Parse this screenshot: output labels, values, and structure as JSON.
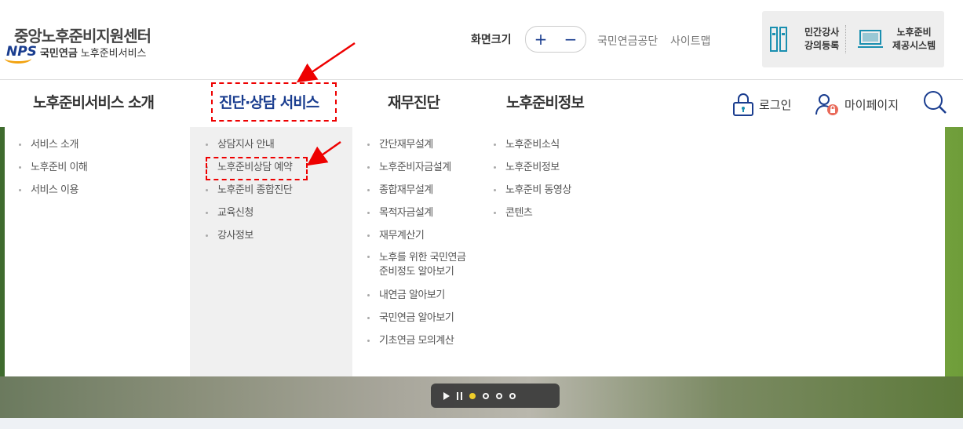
{
  "header": {
    "site_title": "중앙노후준비지원센터",
    "nps_logo": "NPS",
    "org_name": "국민연금",
    "service_name": "노후준비서비스",
    "zoom_label": "화면크기",
    "zoom_in": "+",
    "zoom_out": "−",
    "link_nps": "국민연금공단",
    "link_sitemap": "사이트맵",
    "ext_lecture_line1": "민간강사",
    "ext_lecture_line2": "강의등록",
    "ext_system_line1": "노후준비",
    "ext_system_line2": "제공시스템"
  },
  "nav": {
    "items": [
      "노후준비서비스 소개",
      "진단·상담 서비스",
      "재무진단",
      "노후준비정보"
    ],
    "active_index": 1,
    "login": "로그인",
    "mypage": "마이페이지"
  },
  "mega_menu": {
    "col1": [
      "서비스 소개",
      "노후준비 이해",
      "서비스 이용"
    ],
    "col2": [
      "상담지사 안내",
      "노후준비상담 예약",
      "노후준비 종합진단",
      "교육신청",
      "강사정보"
    ],
    "col3": [
      "간단재무설계",
      "노후준비자금설계",
      "종합재무설계",
      "목적자금설계",
      "재무계산기",
      "노후를 위한 국민연금",
      "준비정도 알아보기",
      "내연금 알아보기",
      "국민연금 알아보기",
      "기초연금 모의계산"
    ],
    "col4": [
      "노후준비소식",
      "노후준비정보",
      "노후준비 동영상",
      "콘텐츠"
    ]
  },
  "colors": {
    "brand_blue": "#1a3d8f",
    "highlight_red": "#e00000",
    "accent_orange": "#f2a20f"
  }
}
